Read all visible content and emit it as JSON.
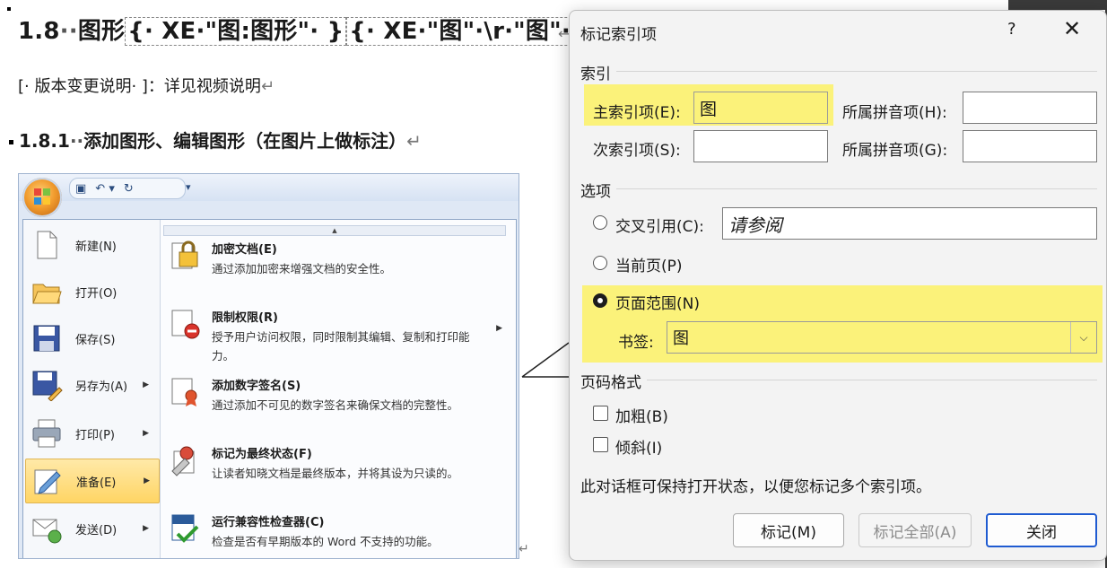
{
  "document": {
    "heading1": {
      "number": "1.8",
      "title": "图形",
      "field1": "{· XE·\"图:图形\"· }",
      "field2": "{· XE·\"图\"·\\r·\"图\"· }"
    },
    "note": "[· 版本变更说明· ]：详见视频说明",
    "heading2": {
      "number": "1.8.1",
      "title": "添加图形、编辑图形（在图片上做标注）"
    },
    "return_mark": "↵"
  },
  "office_menu": {
    "left_items": [
      {
        "label": "新建(N)",
        "icon": "new-document-icon",
        "arrow": false
      },
      {
        "label": "打开(O)",
        "icon": "open-folder-icon",
        "arrow": false
      },
      {
        "label": "保存(S)",
        "icon": "save-disk-icon",
        "arrow": false
      },
      {
        "label": "另存为(A)",
        "icon": "save-as-icon",
        "arrow": true
      },
      {
        "label": "打印(P)",
        "icon": "printer-icon",
        "arrow": true
      },
      {
        "label": "准备(E)",
        "icon": "prepare-icon",
        "arrow": true,
        "selected": true
      },
      {
        "label": "发送(D)",
        "icon": "send-icon",
        "arrow": true
      }
    ],
    "sub_items": [
      {
        "title": "加密文档(E)",
        "desc": "通过添加加密来增强文档的安全性。",
        "icon": "lock-icon"
      },
      {
        "title": "限制权限(R)",
        "desc": "授予用户访问权限，同时限制其编辑、复制和打印能力。",
        "icon": "restrict-permission-icon"
      },
      {
        "title": "添加数字签名(S)",
        "desc": "通过添加不可见的数字签名来确保文档的完整性。",
        "icon": "digital-signature-icon"
      },
      {
        "title": "标记为最终状态(F)",
        "desc": "让读者知晓文档是最终版本，并将其设为只读的。",
        "icon": "mark-final-icon"
      },
      {
        "title": "运行兼容性检查器(C)",
        "desc": "检查是否有早期版本的 Word 不支持的功能。",
        "icon": "compatibility-check-icon"
      }
    ]
  },
  "dialog": {
    "title": "标记索引项",
    "help": "?",
    "close_glyph": "✕",
    "group_index": "索引",
    "main_entry_label": "主索引项(E):",
    "main_entry_value": "图",
    "main_pinyin_label": "所属拼音项(H):",
    "main_pinyin_value": "",
    "sub_entry_label": "次索引项(S):",
    "sub_entry_value": "",
    "sub_pinyin_label": "所属拼音项(G):",
    "sub_pinyin_value": "",
    "group_options": "选项",
    "cross_ref_label": "交叉引用(C):",
    "cross_ref_value": "请参阅",
    "current_page_label": "当前页(P)",
    "page_range_label": "页面范围(N)",
    "bookmark_label": "书签:",
    "bookmark_value": "图",
    "group_format": "页码格式",
    "bold_label": "加粗(B)",
    "italic_label": "倾斜(I)",
    "info": "此对话框可保持打开状态，以便您标记多个索引项。",
    "buttons": {
      "mark": "标记(M)",
      "mark_all": "标记全部(A)",
      "close": "关闭"
    }
  },
  "colors": {
    "highlight": "#fbf27a",
    "default_button_border": "#1f5bd1",
    "menu_selected": "#ffd564"
  }
}
